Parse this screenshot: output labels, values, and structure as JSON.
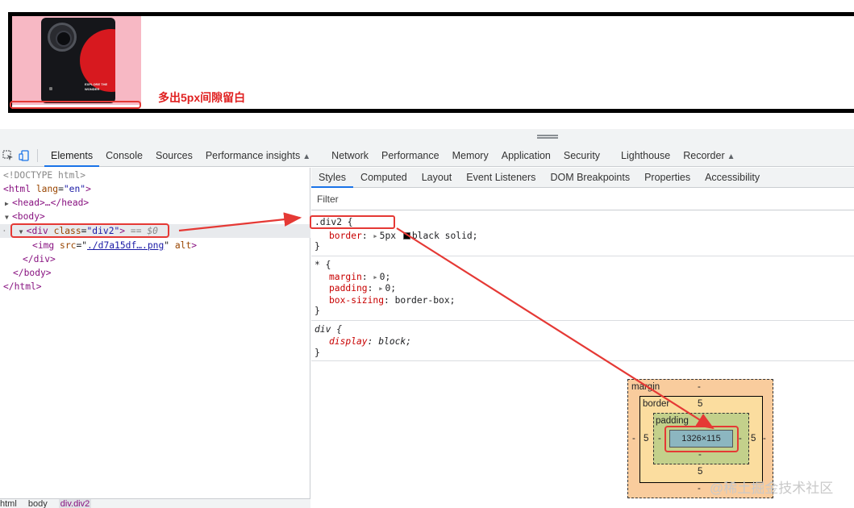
{
  "viewport": {
    "note": "多出5px间隙留白",
    "phone_text": "EXPLORE THE WONDER"
  },
  "devtools": {
    "tabs": [
      {
        "label": "Elements",
        "active": true
      },
      {
        "label": "Console"
      },
      {
        "label": "Sources"
      },
      {
        "label": "Performance insights",
        "experimental": true
      },
      {
        "label": "Network"
      },
      {
        "label": "Performance"
      },
      {
        "label": "Memory"
      },
      {
        "label": "Application"
      },
      {
        "label": "Security"
      },
      {
        "label": "Lighthouse"
      },
      {
        "label": "Recorder",
        "experimental": true
      }
    ],
    "accent_color": "#1a73e8"
  },
  "dom": {
    "doctype": "<!DOCTYPE html>",
    "html_tag": "html",
    "html_attr": "lang",
    "html_lang": "\"en\"",
    "head": "<head>…</head>",
    "body": "<body>",
    "div_tag": "div",
    "div_attr": "class",
    "div_class": "\"div2\"",
    "div_marker": "== $0",
    "img_tag": "img",
    "img_attr": "src",
    "img_src": "./d7a15df….png",
    "img_alt": "alt",
    "div_close": "</div>",
    "body_close": "</body>",
    "html_close": "</html>"
  },
  "breadcrumbs": [
    "html",
    "body",
    "div.div2"
  ],
  "styles": {
    "tabs": [
      {
        "label": "Styles",
        "active": true
      },
      {
        "label": "Computed"
      },
      {
        "label": "Layout"
      },
      {
        "label": "Event Listeners"
      },
      {
        "label": "DOM Breakpoints"
      },
      {
        "label": "Properties"
      },
      {
        "label": "Accessibility"
      }
    ],
    "filter_placeholder": "Filter",
    "rule1_selector": ".div2 {",
    "rule1_prop": "border",
    "rule1_value_a": "5px",
    "rule1_value_b": "black solid;",
    "rule2_selector": "* {",
    "rule2_p1": "margin",
    "rule2_v1": "0;",
    "rule2_p2": "padding",
    "rule2_v2": "0;",
    "rule2_p3": "box-sizing",
    "rule2_v3": "border-box;",
    "rule3_selector": "div {",
    "rule3_prop": "display",
    "rule3_value": "block;",
    "close_brace": "}"
  },
  "box_model": {
    "margin_label": "margin",
    "margin_top": "-",
    "margin_bottom": "-",
    "margin_left": "-",
    "margin_right": "-",
    "border_label": "border",
    "border_top": "5",
    "border_bottom": "5",
    "border_left": "5",
    "border_right": "5",
    "padding_label": "padding",
    "padding_top": "-",
    "padding_bottom": "-",
    "padding_left": "-",
    "padding_right": "-",
    "content_size": "1326×115"
  },
  "watermark": "@稀土掘金技术社区"
}
